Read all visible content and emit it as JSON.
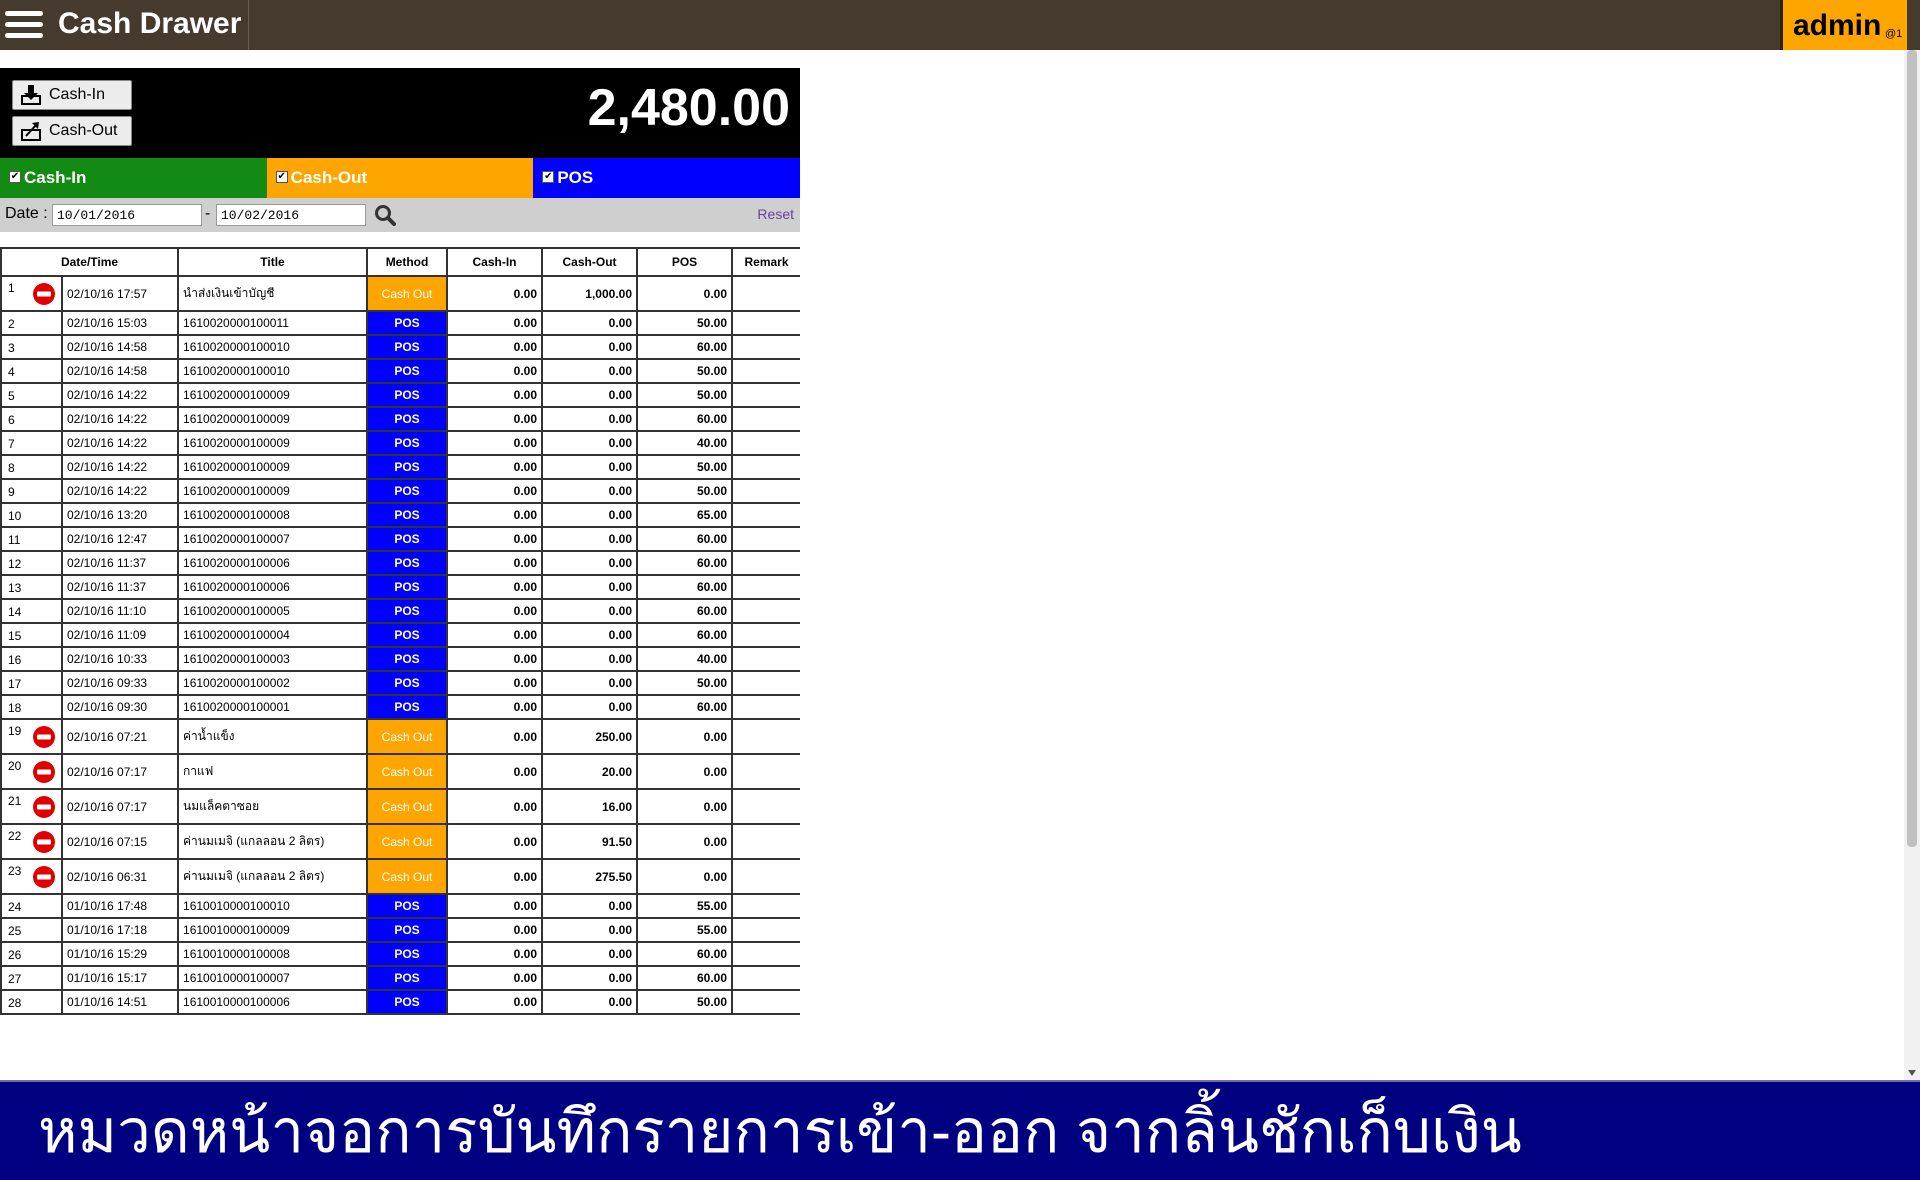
{
  "app": {
    "title": "Cash Drawer",
    "user": "admin",
    "user_sub": "@1"
  },
  "toolbar": {
    "cash_in_label": "Cash-In",
    "cash_out_label": "Cash-Out",
    "total": "2,480.00"
  },
  "filters": [
    {
      "label": "Cash-In",
      "color": "#138a13",
      "checked": true
    },
    {
      "label": "Cash-Out",
      "color": "#ffa500",
      "checked": true
    },
    {
      "label": "POS",
      "color": "#0000ff",
      "checked": true
    }
  ],
  "date_filter": {
    "label": "Date :",
    "from": "10/01/2016",
    "to": "10/02/2016",
    "separator": "-",
    "reset_label": "Reset"
  },
  "table": {
    "headers": [
      "Date/Time",
      "Title",
      "Method",
      "Cash-In",
      "Cash-Out",
      "POS",
      "Remark"
    ],
    "rows": [
      {
        "no": "1",
        "dt": "02/10/16 17:57",
        "title": "นำส่งเงินเข้าบัญชี",
        "method": "Cash Out",
        "in": "0.00",
        "out": "1,000.00",
        "pos": "0.00",
        "remark": "",
        "stop": true
      },
      {
        "no": "2",
        "dt": "02/10/16 15:03",
        "title": "1610020000100011",
        "method": "POS",
        "in": "0.00",
        "out": "0.00",
        "pos": "50.00",
        "remark": ""
      },
      {
        "no": "3",
        "dt": "02/10/16 14:58",
        "title": "1610020000100010",
        "method": "POS",
        "in": "0.00",
        "out": "0.00",
        "pos": "60.00",
        "remark": ""
      },
      {
        "no": "4",
        "dt": "02/10/16 14:58",
        "title": "1610020000100010",
        "method": "POS",
        "in": "0.00",
        "out": "0.00",
        "pos": "50.00",
        "remark": ""
      },
      {
        "no": "5",
        "dt": "02/10/16 14:22",
        "title": "1610020000100009",
        "method": "POS",
        "in": "0.00",
        "out": "0.00",
        "pos": "50.00",
        "remark": ""
      },
      {
        "no": "6",
        "dt": "02/10/16 14:22",
        "title": "1610020000100009",
        "method": "POS",
        "in": "0.00",
        "out": "0.00",
        "pos": "60.00",
        "remark": ""
      },
      {
        "no": "7",
        "dt": "02/10/16 14:22",
        "title": "1610020000100009",
        "method": "POS",
        "in": "0.00",
        "out": "0.00",
        "pos": "40.00",
        "remark": ""
      },
      {
        "no": "8",
        "dt": "02/10/16 14:22",
        "title": "1610020000100009",
        "method": "POS",
        "in": "0.00",
        "out": "0.00",
        "pos": "50.00",
        "remark": ""
      },
      {
        "no": "9",
        "dt": "02/10/16 14:22",
        "title": "1610020000100009",
        "method": "POS",
        "in": "0.00",
        "out": "0.00",
        "pos": "50.00",
        "remark": ""
      },
      {
        "no": "10",
        "dt": "02/10/16 13:20",
        "title": "1610020000100008",
        "method": "POS",
        "in": "0.00",
        "out": "0.00",
        "pos": "65.00",
        "remark": ""
      },
      {
        "no": "11",
        "dt": "02/10/16 12:47",
        "title": "1610020000100007",
        "method": "POS",
        "in": "0.00",
        "out": "0.00",
        "pos": "60.00",
        "remark": ""
      },
      {
        "no": "12",
        "dt": "02/10/16 11:37",
        "title": "1610020000100006",
        "method": "POS",
        "in": "0.00",
        "out": "0.00",
        "pos": "60.00",
        "remark": ""
      },
      {
        "no": "13",
        "dt": "02/10/16 11:37",
        "title": "1610020000100006",
        "method": "POS",
        "in": "0.00",
        "out": "0.00",
        "pos": "60.00",
        "remark": ""
      },
      {
        "no": "14",
        "dt": "02/10/16 11:10",
        "title": "1610020000100005",
        "method": "POS",
        "in": "0.00",
        "out": "0.00",
        "pos": "60.00",
        "remark": ""
      },
      {
        "no": "15",
        "dt": "02/10/16 11:09",
        "title": "1610020000100004",
        "method": "POS",
        "in": "0.00",
        "out": "0.00",
        "pos": "60.00",
        "remark": ""
      },
      {
        "no": "16",
        "dt": "02/10/16 10:33",
        "title": "1610020000100003",
        "method": "POS",
        "in": "0.00",
        "out": "0.00",
        "pos": "40.00",
        "remark": ""
      },
      {
        "no": "17",
        "dt": "02/10/16 09:33",
        "title": "1610020000100002",
        "method": "POS",
        "in": "0.00",
        "out": "0.00",
        "pos": "50.00",
        "remark": ""
      },
      {
        "no": "18",
        "dt": "02/10/16 09:30",
        "title": "1610020000100001",
        "method": "POS",
        "in": "0.00",
        "out": "0.00",
        "pos": "60.00",
        "remark": ""
      },
      {
        "no": "19",
        "dt": "02/10/16 07:21",
        "title": "ค่าน้ำแข็ง",
        "method": "Cash Out",
        "in": "0.00",
        "out": "250.00",
        "pos": "0.00",
        "remark": "",
        "stop": true
      },
      {
        "no": "20",
        "dt": "02/10/16 07:17",
        "title": "กาแฟ",
        "method": "Cash Out",
        "in": "0.00",
        "out": "20.00",
        "pos": "0.00",
        "remark": "",
        "stop": true
      },
      {
        "no": "21",
        "dt": "02/10/16 07:17",
        "title": "นมแล็คตาซอย",
        "method": "Cash Out",
        "in": "0.00",
        "out": "16.00",
        "pos": "0.00",
        "remark": "",
        "stop": true
      },
      {
        "no": "22",
        "dt": "02/10/16 07:15",
        "title": "ค่านมเมจิ (แกลลอน 2 ลิตร)",
        "method": "Cash Out",
        "in": "0.00",
        "out": "91.50",
        "pos": "0.00",
        "remark": "",
        "stop": true
      },
      {
        "no": "23",
        "dt": "02/10/16 06:31",
        "title": "ค่านมเมจิ (แกลลอน 2 ลิตร)",
        "method": "Cash Out",
        "in": "0.00",
        "out": "275.50",
        "pos": "0.00",
        "remark": "",
        "stop": true
      },
      {
        "no": "24",
        "dt": "01/10/16 17:48",
        "title": "1610010000100010",
        "method": "POS",
        "in": "0.00",
        "out": "0.00",
        "pos": "55.00",
        "remark": ""
      },
      {
        "no": "25",
        "dt": "01/10/16 17:18",
        "title": "1610010000100009",
        "method": "POS",
        "in": "0.00",
        "out": "0.00",
        "pos": "55.00",
        "remark": ""
      },
      {
        "no": "26",
        "dt": "01/10/16 15:29",
        "title": "1610010000100008",
        "method": "POS",
        "in": "0.00",
        "out": "0.00",
        "pos": "60.00",
        "remark": ""
      },
      {
        "no": "27",
        "dt": "01/10/16 15:17",
        "title": "1610010000100007",
        "method": "POS",
        "in": "0.00",
        "out": "0.00",
        "pos": "60.00",
        "remark": ""
      },
      {
        "no": "28",
        "dt": "01/10/16 14:51",
        "title": "1610010000100006",
        "method": "POS",
        "in": "0.00",
        "out": "0.00",
        "pos": "50.00",
        "remark": ""
      }
    ]
  },
  "caption": "หมวดหน้าจอการบันทึกรายการเข้า-ออก จากลิ้นชักเก็บเงิน",
  "colors": {
    "topbar": "#463a2f",
    "user_badge": "#ffa500",
    "cash_in": "#138a13",
    "cash_out": "#ffa500",
    "pos": "#0000ff",
    "caption_bg": "#000080"
  }
}
